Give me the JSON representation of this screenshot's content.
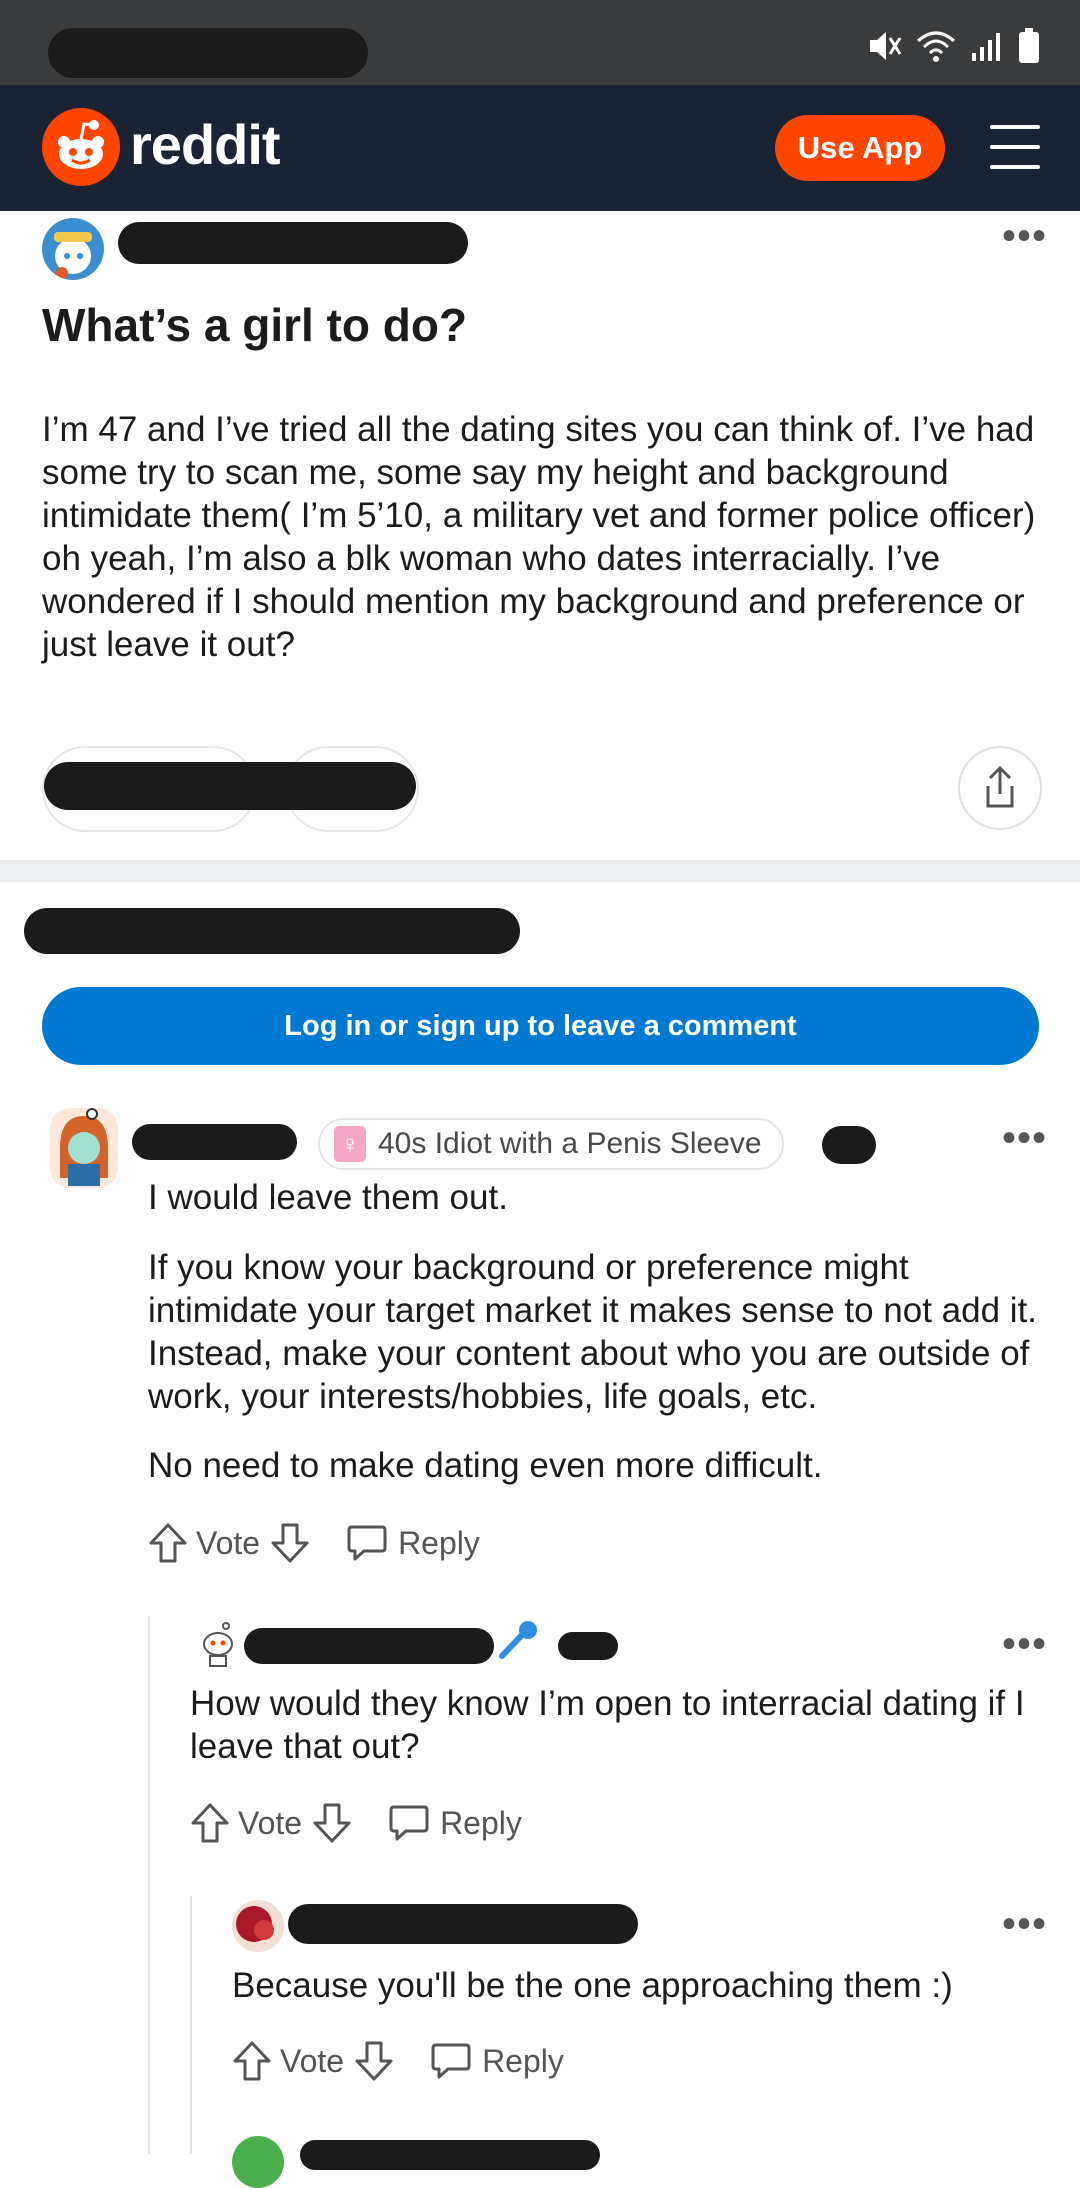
{
  "status_bar": {
    "icons": [
      "mute-icon",
      "wifi-icon",
      "signal-icon",
      "battery-icon"
    ]
  },
  "header": {
    "brand": "reddit",
    "use_app_label": "Use App"
  },
  "post": {
    "title": "What’s a girl to do?",
    "body": "I’m 47 and I’ve tried all the dating sites you can think of. I’ve had some try to scan me, some say my height and background intimidate them( I’m 5’10, a military vet and former police officer) oh yeah, I’m also a blk woman who dates interracially. I’ve wondered if I should mention my background and preference or just leave it out?",
    "more_label": "•••"
  },
  "login_label": "Log in or sign up to leave a comment",
  "comments": [
    {
      "flair": "40s Idiot with a Penis Sleeve",
      "flair_emoji": "♀",
      "paragraphs": [
        "I would leave them out.",
        "If you know your background or preference might intimidate your target market it makes sense to not add it. Instead, make your content about who you are outside of work, your interests/hobbies, life goals, etc.",
        "No need to make dating even more difficult."
      ],
      "vote_label": "Vote",
      "reply_label": "Reply"
    },
    {
      "text": "How would they know I’m open to interracial dating if I leave that out?",
      "vote_label": "Vote",
      "reply_label": "Reply"
    },
    {
      "text": "Because you'll be the one approaching them :)",
      "vote_label": "Vote",
      "reply_label": "Reply"
    }
  ],
  "colors": {
    "brand": "#ff4500",
    "header_bg": "#1a2333",
    "login_blue": "#0079d3"
  }
}
